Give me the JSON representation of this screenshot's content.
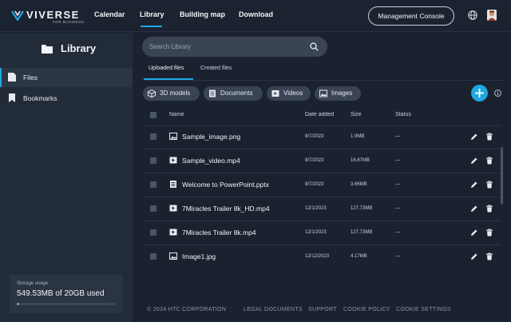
{
  "brand": {
    "name": "VIVERSE",
    "sub": "FOR BUSINESS"
  },
  "nav": {
    "items": [
      "Calendar",
      "Library",
      "Building map",
      "Download"
    ],
    "active": "Library",
    "management_button": "Management Console"
  },
  "sidebar": {
    "title": "Library",
    "items": [
      {
        "label": "Files",
        "active": true
      },
      {
        "label": "Bookmarks",
        "active": false
      }
    ],
    "storage": {
      "caption": "Storage usage",
      "value": "549.53MB of 20GB used",
      "fraction": 0.027
    }
  },
  "search": {
    "placeholder": "Search Library"
  },
  "tabs": [
    "Uploaded files",
    "Created files"
  ],
  "filters": [
    "3D models",
    "Documents",
    "Videos",
    "Images"
  ],
  "table": {
    "headers": [
      "Name",
      "Date added",
      "Size",
      "Status"
    ],
    "rows": [
      {
        "name": "Sample_image.png",
        "type": "image",
        "date": "8/7/2023",
        "size": "1.9MB",
        "status": "—"
      },
      {
        "name": "Sample_video.mp4",
        "type": "video",
        "date": "8/7/2023",
        "size": "16.67MB",
        "status": "—"
      },
      {
        "name": "Welcome to PowerPoint.pptx",
        "type": "document",
        "date": "8/7/2023",
        "size": "3.66MB",
        "status": "—"
      },
      {
        "name": "7Miracles Trailer 8k_HD.mp4",
        "type": "video",
        "date": "12/1/2023",
        "size": "127.73MB",
        "status": "—"
      },
      {
        "name": "7Miracles Trailer 8k.mp4",
        "type": "video",
        "date": "12/1/2023",
        "size": "127.73MB",
        "status": "—"
      },
      {
        "name": "Image1.jpg",
        "type": "image",
        "date": "12/12/2023",
        "size": "4.17MB",
        "status": "—"
      }
    ]
  },
  "footer": [
    "© 2024 HTC CORPORATION",
    "LEGAL DOCUMENTS",
    "SUPPORT",
    "COOKIE POLICY",
    "COOKIE SETTINGS"
  ],
  "colors": {
    "accent": "#1ea7e0",
    "background": "#1a2230",
    "sidebar": "#222b38",
    "chip": "#3a4455"
  }
}
